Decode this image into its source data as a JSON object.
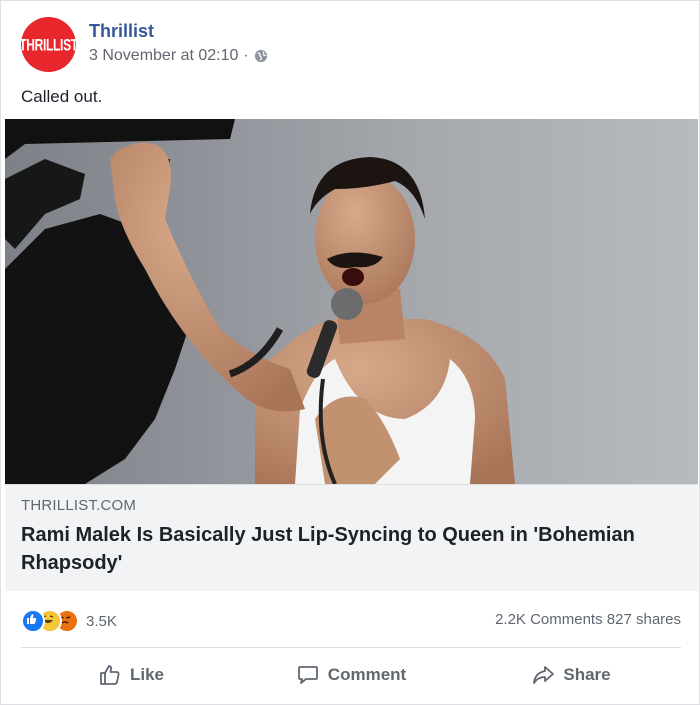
{
  "post": {
    "page_name": "Thrillist",
    "avatar_text": "THRILLIST",
    "timestamp": "3 November at 02:10",
    "separator": "·",
    "privacy_icon": "globe-icon",
    "message": "Called out."
  },
  "link": {
    "image_description": "Concert photo of a singer in a white tank top raising a fist and holding a microphone",
    "domain": "THRILLIST.COM",
    "headline": "Rami Malek Is Basically Just Lip-Syncing to Queen in 'Bohemian Rhapsody'"
  },
  "stats": {
    "reaction_icons": [
      "like-icon",
      "haha-icon",
      "angry-icon"
    ],
    "reaction_count": "3.5K",
    "comments": "2.2K Comments",
    "shares": "827 shares"
  },
  "actions": {
    "like": "Like",
    "comment": "Comment",
    "share": "Share"
  },
  "colors": {
    "brand_red": "#e8272d",
    "link_blue": "#365899",
    "like_blue": "#1877f2",
    "haha_yellow": "#f7c53a",
    "angry_orange": "#e9710f"
  }
}
